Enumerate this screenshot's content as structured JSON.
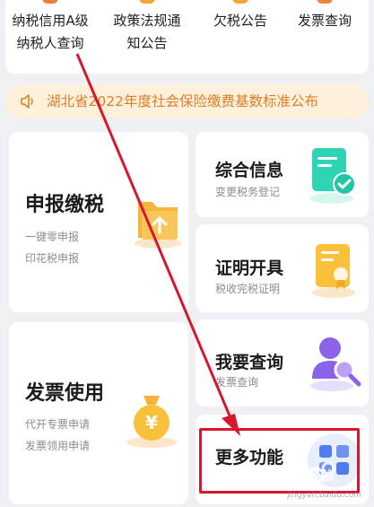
{
  "quick_links": [
    {
      "label_line1": "纳税信用A级",
      "label_line2": "纳税人查询",
      "icon": "credit-icon"
    },
    {
      "label_line1": "政策法规通",
      "label_line2": "知公告",
      "icon": "policy-icon"
    },
    {
      "label_line1": "欠税公告",
      "label_line2": "",
      "icon": "announcement-icon"
    },
    {
      "label_line1": "发票查询",
      "label_line2": "",
      "icon": "invoice-search-icon"
    }
  ],
  "notice": {
    "text": "湖北省2022年度社会保险缴费基数标准公布",
    "icon": "speaker-icon"
  },
  "tiles": {
    "report": {
      "title": "申报缴税",
      "sub1": "一键零申报",
      "sub2": "印花税申报",
      "icon": "folder-upload-icon"
    },
    "invoice": {
      "title": "发票使用",
      "sub1": "代开专票申请",
      "sub2": "发票领用申请",
      "icon": "money-bag-icon"
    },
    "info": {
      "title": "综合信息",
      "sub": "变更税务登记",
      "icon": "document-check-icon"
    },
    "cert": {
      "title": "证明开具",
      "sub": "税收完税证明",
      "icon": "certificate-icon"
    },
    "query": {
      "title": "我要查询",
      "sub": "发票查询",
      "icon": "user-search-icon"
    },
    "more": {
      "title": "更多功能",
      "icon": "grid-apps-icon"
    }
  },
  "watermark": {
    "text": "经验",
    "url": "jingyan.baidu.com"
  },
  "colors": {
    "notice_text": "#e07e27",
    "notice_bg": "#fdf1dc",
    "highlight": "#d8172f",
    "orange_icon": "#f5a623",
    "teal_icon": "#2fd3b5",
    "purple_icon": "#8a63e8"
  }
}
